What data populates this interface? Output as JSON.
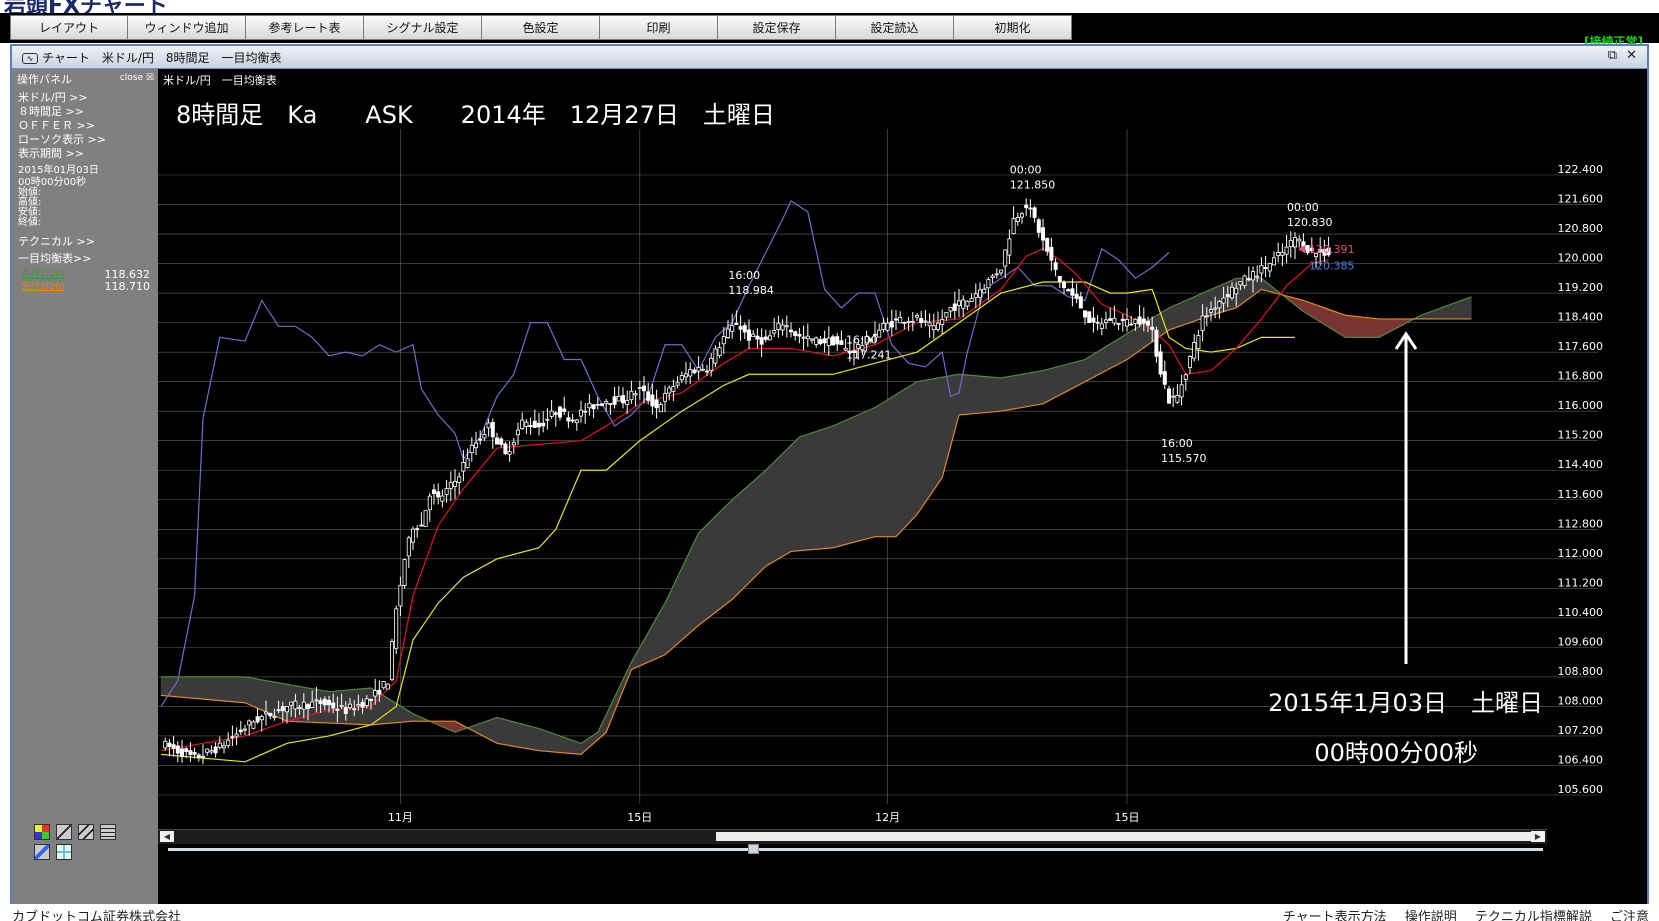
{
  "app": {
    "logo": "岩頭FXチャート",
    "connection_status": "[接続正常]"
  },
  "menu": [
    "レイアウト",
    "ウィンドウ追加",
    "参考レート表",
    "シグナル設定",
    "色設定",
    "印刷",
    "設定保存",
    "設定読込",
    "初期化"
  ],
  "window": {
    "title": "チャート　米ドル/円　8時間足　一目均衡表",
    "restore_glyph": "⧉",
    "close_glyph": "✕"
  },
  "panel": {
    "header": "操作パネル",
    "close_label": "close",
    "items": [
      "米ドル/円 >>",
      "８時間足 >>",
      "ＯＦＦＥＲ >>",
      "ローソク表示 >>",
      "表示期間 >>"
    ],
    "date": "2015年01月03日",
    "time": "00時00分00秒",
    "ohlc_labels": [
      "始値:",
      "高値:",
      "安値:",
      "終値:"
    ],
    "technical": "テクニカル >>",
    "ichimoku": "一目均衡表>>",
    "span_a_label": "先行1(26)",
    "span_a_value": "118.632",
    "span_b_label": "先行2(26)",
    "span_b_value": "118.710"
  },
  "colors": {
    "candle": "#ffffff",
    "tenkan": "#e0141e",
    "kijun": "#e6e619",
    "chikou": "#7a68c8",
    "span_a": "#4f8a3c",
    "span_b": "#e08a1e",
    "kumo_bull": "#3a3a3a",
    "kumo_bear": "#7a3434",
    "last_price": "#e6507a",
    "secondary_price": "#4f7fdf"
  },
  "chart_data": {
    "type": "candlestick",
    "symbol_label": "米ドル/円　一目均衡表",
    "header_overlay": "8時間足　Ka　　ASK　　2014年　12月27日　土曜日",
    "y_ticks": [
      "122.400",
      "121.600",
      "120.800",
      "120.000",
      "119.200",
      "118.400",
      "117.600",
      "116.800",
      "116.000",
      "115.200",
      "114.400",
      "113.600",
      "112.800",
      "112.000",
      "111.200",
      "110.400",
      "109.600",
      "108.800",
      "108.000",
      "107.200",
      "106.400",
      "105.600"
    ],
    "ylim": [
      105.2,
      122.9
    ],
    "x_ticks": [
      {
        "label": "11月",
        "index": 57
      },
      {
        "label": "15日",
        "index": 114
      },
      {
        "label": "12月",
        "index": 173
      },
      {
        "label": "15日",
        "index": 230
      }
    ],
    "annotations": [
      {
        "time": "16:00",
        "value": "118.984",
        "index": 137
      },
      {
        "time": "16:00",
        "value": "117.241",
        "index": 165
      },
      {
        "time": "00:00",
        "value": "121.850",
        "index": 204
      },
      {
        "time": "00:00",
        "value": "120.830",
        "index": 270
      },
      {
        "time": "16:00",
        "value": "115.570",
        "index": 240
      }
    ],
    "last_price": "120.391",
    "second_price": "120.385",
    "target_date": "2015年1月03日　土曜日",
    "target_time": "00時00分00秒",
    "anchors": [
      [
        0,
        107.0
      ],
      [
        8,
        106.6
      ],
      [
        14,
        106.9
      ],
      [
        22,
        107.6
      ],
      [
        30,
        108.0
      ],
      [
        38,
        108.1
      ],
      [
        44,
        107.9
      ],
      [
        50,
        108.2
      ],
      [
        54,
        108.7
      ],
      [
        56,
        110.6
      ],
      [
        58,
        112.0
      ],
      [
        60,
        112.9
      ],
      [
        62,
        112.9
      ],
      [
        64,
        113.8
      ],
      [
        66,
        113.6
      ],
      [
        70,
        114.1
      ],
      [
        74,
        115.0
      ],
      [
        78,
        115.6
      ],
      [
        82,
        114.8
      ],
      [
        86,
        115.7
      ],
      [
        90,
        115.6
      ],
      [
        94,
        116.0
      ],
      [
        98,
        115.8
      ],
      [
        102,
        116.1
      ],
      [
        106,
        116.3
      ],
      [
        110,
        116.3
      ],
      [
        114,
        116.6
      ],
      [
        118,
        116.1
      ],
      [
        122,
        116.7
      ],
      [
        126,
        117.1
      ],
      [
        130,
        117.2
      ],
      [
        134,
        118.0
      ],
      [
        137,
        118.4
      ],
      [
        140,
        118.0
      ],
      [
        144,
        117.9
      ],
      [
        148,
        118.4
      ],
      [
        152,
        118.0
      ],
      [
        156,
        117.9
      ],
      [
        160,
        117.9
      ],
      [
        164,
        117.6
      ],
      [
        168,
        117.9
      ],
      [
        172,
        118.3
      ],
      [
        176,
        118.5
      ],
      [
        180,
        118.5
      ],
      [
        184,
        118.2
      ],
      [
        188,
        118.8
      ],
      [
        192,
        119.0
      ],
      [
        196,
        119.4
      ],
      [
        200,
        119.9
      ],
      [
        203,
        121.2
      ],
      [
        206,
        121.6
      ],
      [
        208,
        121.2
      ],
      [
        210,
        120.6
      ],
      [
        214,
        119.5
      ],
      [
        218,
        119.0
      ],
      [
        222,
        118.3
      ],
      [
        226,
        118.5
      ],
      [
        230,
        118.4
      ],
      [
        234,
        118.5
      ],
      [
        236,
        118.1
      ],
      [
        238,
        117.1
      ],
      [
        240,
        116.3
      ],
      [
        242,
        116.4
      ],
      [
        244,
        117.1
      ],
      [
        248,
        118.5
      ],
      [
        252,
        119.0
      ],
      [
        256,
        119.4
      ],
      [
        260,
        119.7
      ],
      [
        264,
        120.0
      ],
      [
        268,
        120.4
      ],
      [
        270,
        120.7
      ],
      [
        274,
        120.3
      ],
      [
        278,
        120.3
      ]
    ],
    "kumo": {
      "span_a": [
        [
          0,
          108.8
        ],
        [
          20,
          108.8
        ],
        [
          40,
          108.4
        ],
        [
          50,
          108.5
        ],
        [
          60,
          107.8
        ],
        [
          70,
          107.3
        ],
        [
          80,
          107.7
        ],
        [
          90,
          107.4
        ],
        [
          100,
          107.0
        ],
        [
          104,
          107.3
        ],
        [
          112,
          109.2
        ],
        [
          120,
          110.8
        ],
        [
          128,
          112.7
        ],
        [
          136,
          113.6
        ],
        [
          144,
          114.4
        ],
        [
          152,
          115.3
        ],
        [
          160,
          115.6
        ],
        [
          170,
          116.1
        ],
        [
          180,
          116.8
        ],
        [
          190,
          117.0
        ],
        [
          200,
          116.9
        ],
        [
          210,
          117.1
        ],
        [
          220,
          117.4
        ],
        [
          230,
          118.1
        ],
        [
          240,
          118.8
        ],
        [
          250,
          119.3
        ],
        [
          256,
          119.6
        ],
        [
          262,
          119.6
        ],
        [
          272,
          118.7
        ],
        [
          282,
          118.0
        ],
        [
          290,
          118.0
        ],
        [
          300,
          118.6
        ],
        [
          312,
          119.1
        ]
      ],
      "span_b": [
        [
          0,
          108.3
        ],
        [
          20,
          108.1
        ],
        [
          30,
          107.6
        ],
        [
          50,
          107.5
        ],
        [
          60,
          107.6
        ],
        [
          70,
          107.6
        ],
        [
          80,
          107.0
        ],
        [
          90,
          106.8
        ],
        [
          100,
          106.7
        ],
        [
          106,
          107.3
        ],
        [
          112,
          109.0
        ],
        [
          120,
          109.4
        ],
        [
          128,
          110.2
        ],
        [
          136,
          110.9
        ],
        [
          144,
          111.8
        ],
        [
          150,
          112.2
        ],
        [
          160,
          112.3
        ],
        [
          170,
          112.6
        ],
        [
          175,
          112.6
        ],
        [
          180,
          113.2
        ],
        [
          186,
          114.2
        ],
        [
          190,
          115.9
        ],
        [
          200,
          116.0
        ],
        [
          210,
          116.2
        ],
        [
          220,
          116.8
        ],
        [
          230,
          117.4
        ],
        [
          240,
          118.2
        ],
        [
          250,
          118.6
        ],
        [
          256,
          118.8
        ],
        [
          262,
          119.3
        ],
        [
          272,
          119.0
        ],
        [
          282,
          118.6
        ],
        [
          290,
          118.5
        ],
        [
          300,
          118.5
        ],
        [
          312,
          118.5
        ]
      ]
    },
    "tenkan": [
      [
        0,
        106.8
      ],
      [
        20,
        107.2
      ],
      [
        30,
        107.6
      ],
      [
        40,
        107.9
      ],
      [
        50,
        108.0
      ],
      [
        56,
        108.7
      ],
      [
        60,
        111.0
      ],
      [
        66,
        112.9
      ],
      [
        72,
        113.9
      ],
      [
        80,
        115.0
      ],
      [
        90,
        115.1
      ],
      [
        100,
        115.2
      ],
      [
        106,
        115.6
      ],
      [
        114,
        116.2
      ],
      [
        124,
        116.5
      ],
      [
        134,
        117.3
      ],
      [
        140,
        117.7
      ],
      [
        150,
        117.7
      ],
      [
        160,
        117.5
      ],
      [
        170,
        117.8
      ],
      [
        180,
        118.4
      ],
      [
        190,
        118.5
      ],
      [
        200,
        119.3
      ],
      [
        206,
        120.2
      ],
      [
        210,
        120.4
      ],
      [
        214,
        120.1
      ],
      [
        218,
        119.7
      ],
      [
        224,
        118.9
      ],
      [
        230,
        118.6
      ],
      [
        236,
        118.2
      ],
      [
        240,
        117.8
      ],
      [
        244,
        117.0
      ],
      [
        250,
        117.1
      ],
      [
        256,
        117.7
      ],
      [
        262,
        118.5
      ],
      [
        268,
        119.4
      ],
      [
        274,
        120.0
      ],
      [
        278,
        120.1
      ]
    ],
    "kijun": [
      [
        0,
        106.7
      ],
      [
        20,
        106.5
      ],
      [
        30,
        107.0
      ],
      [
        40,
        107.2
      ],
      [
        50,
        107.5
      ],
      [
        56,
        108.0
      ],
      [
        60,
        109.8
      ],
      [
        66,
        110.8
      ],
      [
        72,
        111.5
      ],
      [
        80,
        112.0
      ],
      [
        90,
        112.3
      ],
      [
        94,
        112.8
      ],
      [
        100,
        114.4
      ],
      [
        106,
        114.4
      ],
      [
        114,
        115.2
      ],
      [
        124,
        116.0
      ],
      [
        134,
        116.7
      ],
      [
        140,
        117.0
      ],
      [
        150,
        117.0
      ],
      [
        160,
        117.0
      ],
      [
        170,
        117.3
      ],
      [
        180,
        117.6
      ],
      [
        190,
        118.4
      ],
      [
        200,
        119.2
      ],
      [
        210,
        119.5
      ],
      [
        220,
        119.5
      ],
      [
        226,
        119.2
      ],
      [
        230,
        119.2
      ],
      [
        236,
        119.3
      ],
      [
        240,
        118.0
      ],
      [
        244,
        117.7
      ],
      [
        250,
        117.6
      ],
      [
        256,
        117.7
      ],
      [
        262,
        118.0
      ],
      [
        270,
        118.0
      ]
    ],
    "chikou": [
      [
        0,
        108.0
      ],
      [
        4,
        108.7
      ],
      [
        8,
        111.0
      ],
      [
        10,
        115.8
      ],
      [
        14,
        118.0
      ],
      [
        20,
        117.9
      ],
      [
        24,
        119.0
      ],
      [
        28,
        118.3
      ],
      [
        32,
        118.3
      ],
      [
        36,
        118.0
      ],
      [
        40,
        117.5
      ],
      [
        44,
        117.6
      ],
      [
        48,
        117.5
      ],
      [
        52,
        117.8
      ],
      [
        56,
        117.6
      ],
      [
        60,
        117.8
      ],
      [
        62,
        116.6
      ],
      [
        66,
        115.9
      ],
      [
        70,
        115.4
      ],
      [
        72,
        114.7
      ],
      [
        76,
        115.3
      ],
      [
        80,
        116.4
      ],
      [
        84,
        117.0
      ],
      [
        88,
        118.4
      ],
      [
        92,
        118.4
      ],
      [
        96,
        117.4
      ],
      [
        100,
        117.4
      ],
      [
        104,
        116.4
      ],
      [
        108,
        115.6
      ],
      [
        112,
        115.9
      ],
      [
        116,
        116.4
      ],
      [
        120,
        117.8
      ],
      [
        124,
        117.8
      ],
      [
        128,
        117.1
      ],
      [
        132,
        118.0
      ],
      [
        136,
        118.4
      ],
      [
        140,
        119.4
      ],
      [
        144,
        120.3
      ],
      [
        148,
        121.2
      ],
      [
        150,
        121.7
      ],
      [
        154,
        121.4
      ],
      [
        158,
        119.3
      ],
      [
        162,
        118.8
      ],
      [
        166,
        119.2
      ],
      [
        170,
        119.2
      ],
      [
        174,
        117.8
      ],
      [
        178,
        117.3
      ],
      [
        182,
        117.2
      ],
      [
        186,
        117.6
      ],
      [
        188,
        116.4
      ],
      [
        190,
        116.5
      ],
      [
        192,
        117.6
      ],
      [
        196,
        119.3
      ],
      [
        200,
        119.6
      ],
      [
        204,
        119.9
      ],
      [
        208,
        119.4
      ],
      [
        212,
        119.4
      ],
      [
        216,
        119.1
      ],
      [
        220,
        119.0
      ],
      [
        224,
        120.4
      ],
      [
        228,
        120.1
      ],
      [
        232,
        119.6
      ],
      [
        236,
        119.9
      ],
      [
        240,
        120.3
      ]
    ]
  }
}
